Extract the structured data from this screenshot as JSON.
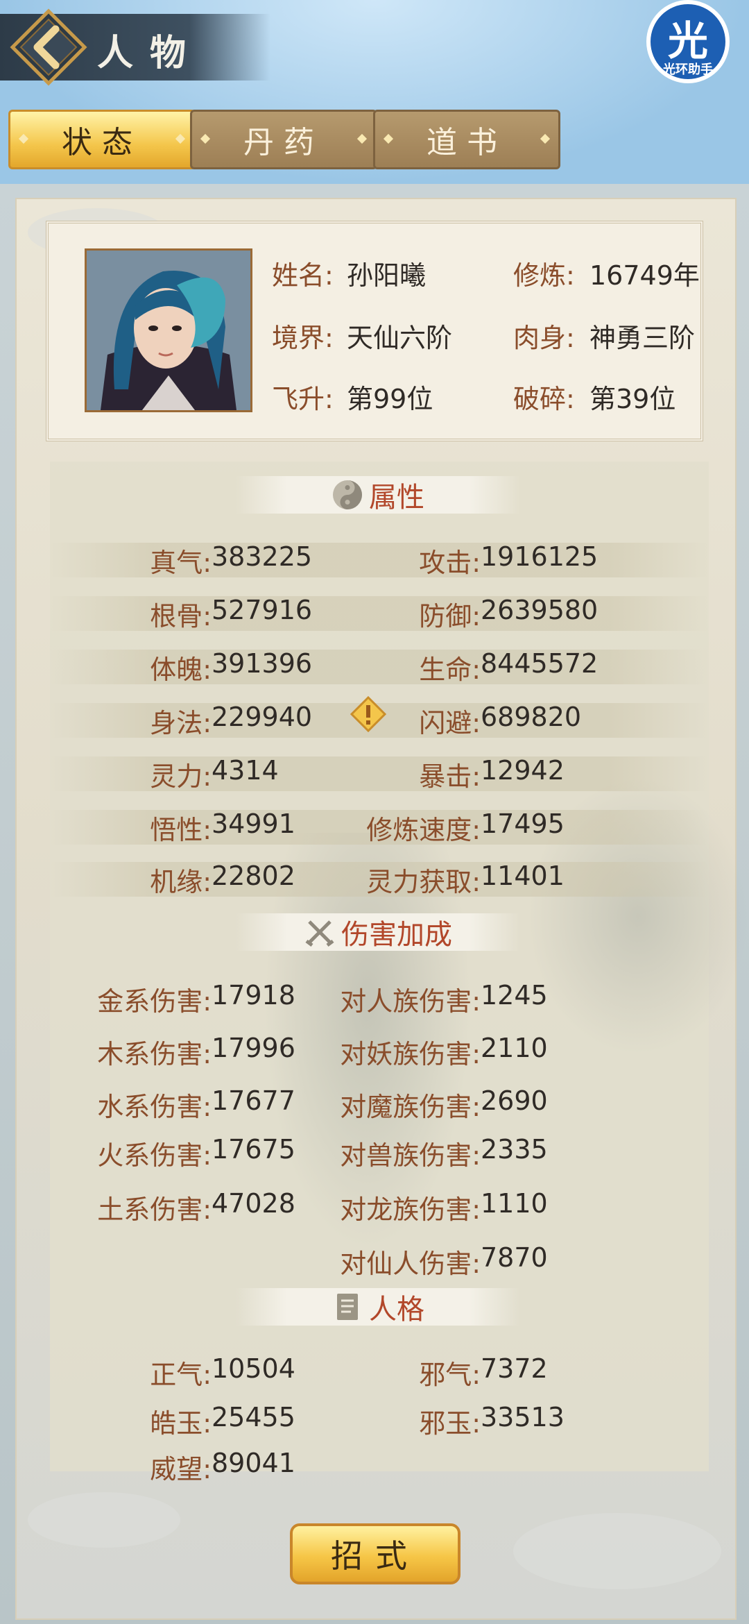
{
  "header": {
    "title": "人物",
    "back_icon": "chevron-left-icon"
  },
  "helper": {
    "glyph": "光",
    "label": "光环助手"
  },
  "tabs": [
    {
      "label": "状态",
      "active": true
    },
    {
      "label": "丹药",
      "active": false
    },
    {
      "label": "道书",
      "active": false
    }
  ],
  "profile": {
    "name_label": "姓名:",
    "name": "孙阳曦",
    "cultivate_label": "修炼:",
    "cultivate": "16749年",
    "realm_label": "境界:",
    "realm": "天仙六阶",
    "body_label": "肉身:",
    "body": "神勇三阶",
    "ascend_label": "飞升:",
    "ascend": "第99位",
    "shatter_label": "破碎:",
    "shatter": "第39位"
  },
  "attributes": {
    "title": "属性",
    "rows": [
      {
        "l_label": "真气:",
        "l_value": "383225",
        "r_label": "攻击:",
        "r_value": "1916125"
      },
      {
        "l_label": "根骨:",
        "l_value": "527916",
        "r_label": "防御:",
        "r_value": "2639580"
      },
      {
        "l_label": "体魄:",
        "l_value": "391396",
        "r_label": "生命:",
        "r_value": "8445572"
      },
      {
        "l_label": "身法:",
        "l_value": "229940",
        "r_label": "闪避:",
        "r_value": "689820"
      },
      {
        "l_label": "灵力:",
        "l_value": "4314",
        "r_label": "暴击:",
        "r_value": "12942"
      },
      {
        "l_label": "悟性:",
        "l_value": "34991",
        "r_label": "修炼速度:",
        "r_value": "17495"
      },
      {
        "l_label": "机缘:",
        "l_value": "22802",
        "r_label": "灵力获取:",
        "r_value": "11401"
      }
    ]
  },
  "damage": {
    "title": "伤害加成",
    "rows": [
      {
        "l_label": "金系伤害:",
        "l_value": "17918",
        "r_label": "对人族伤害:",
        "r_value": "1245"
      },
      {
        "l_label": "木系伤害:",
        "l_value": "17996",
        "r_label": "对妖族伤害:",
        "r_value": "2110"
      },
      {
        "l_label": "水系伤害:",
        "l_value": "17677",
        "r_label": "对魔族伤害:",
        "r_value": "2690"
      },
      {
        "l_label": "火系伤害:",
        "l_value": "17675",
        "r_label": "对兽族伤害:",
        "r_value": "2335"
      },
      {
        "l_label": "土系伤害:",
        "l_value": "47028",
        "r_label": "对龙族伤害:",
        "r_value": "1110"
      },
      {
        "r_label": "对仙人伤害:",
        "r_value": "7870"
      }
    ]
  },
  "personality": {
    "title": "人格",
    "rows": [
      {
        "l_label": "正气:",
        "l_value": "10504",
        "r_label": "邪气:",
        "r_value": "7372"
      },
      {
        "l_label": "皓玉:",
        "l_value": "25455",
        "r_label": "邪玉:",
        "r_value": "33513"
      },
      {
        "l_label": "威望:",
        "l_value": "89041"
      }
    ]
  },
  "bottom": {
    "skill_label": "招式"
  },
  "colors": {
    "accent_gold": "#f4c64b",
    "label_brown": "#8a4d2b",
    "section_red": "#b2472a"
  }
}
